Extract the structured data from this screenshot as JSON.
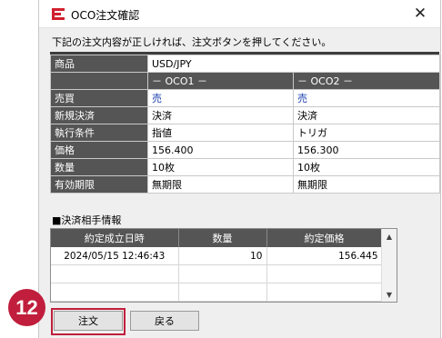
{
  "window": {
    "title": "OCO注文確認",
    "close_symbol": "✕",
    "message": "下記の注文内容が正しければ、注文ボタンを押してください。"
  },
  "order": {
    "product_label": "商品",
    "product_value": "USD/JPY",
    "oco1_header": "－ OCO1 －",
    "oco2_header": "－ OCO2 －",
    "rows": [
      {
        "label": "売買",
        "oco1": "売",
        "oco2": "売"
      },
      {
        "label": "新規決済",
        "oco1": "決済",
        "oco2": "決済"
      },
      {
        "label": "執行条件",
        "oco1": "指値",
        "oco2": "トリガ"
      },
      {
        "label": "価格",
        "oco1": "156.400",
        "oco2": "156.300"
      },
      {
        "label": "数量",
        "oco1": "10枚",
        "oco2": "10枚"
      },
      {
        "label": "有効期限",
        "oco1": "無期限",
        "oco2": "無期限"
      }
    ]
  },
  "settlement": {
    "section_title": "■決済相手情報",
    "columns": [
      "約定成立日時",
      "数量",
      "約定価格"
    ],
    "rows": [
      {
        "datetime": "2024/05/15 12:46:43",
        "qty": "10",
        "price": "156.445"
      }
    ],
    "scroll_up": "▲",
    "scroll_down": "▼"
  },
  "buttons": {
    "order": "注文",
    "back": "戻る"
  },
  "annotation": {
    "step": "12"
  },
  "colors": {
    "label_bg": "#555555",
    "sell_text": "#1a3fb0",
    "highlight": "#c01e3c",
    "app_icon": "#d0202e"
  }
}
